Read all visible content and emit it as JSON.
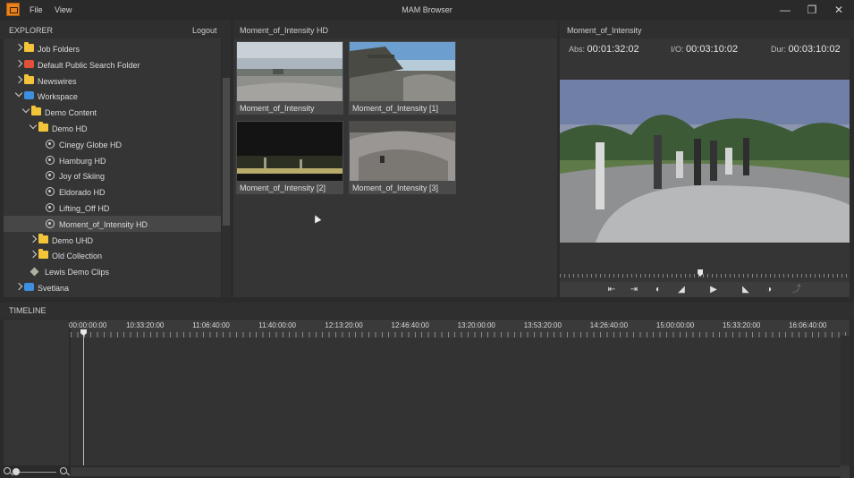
{
  "window": {
    "title": "MAM Browser",
    "menu": [
      "File",
      "View"
    ]
  },
  "explorer": {
    "title": "EXPLORER",
    "logout": "Logout",
    "items": [
      {
        "label": "Job Folders",
        "icon": "folder-icon",
        "level": 1,
        "state": "closed"
      },
      {
        "label": "Default Public Search Folder",
        "icon": "search-folder-icon",
        "level": 1,
        "state": "closed"
      },
      {
        "label": "Newswires",
        "icon": "folder-icon",
        "level": 1,
        "state": "closed"
      },
      {
        "label": "Workspace",
        "icon": "workspace-icon",
        "level": 1,
        "state": "open"
      },
      {
        "label": "Demo Content",
        "icon": "folder-icon",
        "level": 2,
        "state": "open"
      },
      {
        "label": "Demo HD",
        "icon": "folder-icon",
        "level": 3,
        "state": "open"
      },
      {
        "label": "Cinegy Globe HD",
        "icon": "clip-icon",
        "level": 4
      },
      {
        "label": "Hamburg HD",
        "icon": "clip-icon",
        "level": 4
      },
      {
        "label": "Joy of Skiing",
        "icon": "clip-icon",
        "level": 4
      },
      {
        "label": "Eldorado HD",
        "icon": "clip-icon",
        "level": 4
      },
      {
        "label": "Lifting_Off HD",
        "icon": "clip-icon",
        "level": 4
      },
      {
        "label": "Moment_of_Intensity HD",
        "icon": "clip-icon",
        "level": 4,
        "selected": true
      },
      {
        "label": "Demo UHD",
        "icon": "folder-icon",
        "level": 3,
        "state": "closed"
      },
      {
        "label": "Old Collection",
        "icon": "folder-icon",
        "level": 3,
        "state": "closed"
      },
      {
        "label": "Lewis Demo Clips",
        "icon": "diamond-icon",
        "level": 2
      },
      {
        "label": "Svetlana",
        "icon": "workspace-icon",
        "level": 1,
        "state": "closed"
      }
    ]
  },
  "content": {
    "title": "Moment_of_Intensity HD",
    "thumbnails": [
      {
        "caption": "Moment_of_Intensity"
      },
      {
        "caption": "Moment_of_Intensity [1]"
      },
      {
        "caption": "Moment_of_Intensity [2]"
      },
      {
        "caption": "Moment_of_Intensity [3]"
      }
    ]
  },
  "viewer": {
    "title": "Moment_of_Intensity",
    "abs_label": "Abs:",
    "abs_value": "00:01:32:02",
    "io_label": "I/O:",
    "io_value": "00:03:10:02",
    "dur_label": "Dur:",
    "dur_value": "00:03:10:02",
    "playback_position": 0.485
  },
  "timeline": {
    "title": "TIMELINE",
    "ruler_labels": [
      "00:00:00:00",
      "10:33:20:00",
      "11:06:40:00",
      "11:40:00:00",
      "12:13:20:00",
      "12:46:40:00",
      "13:20:00:00",
      "13:53:20:00",
      "14:26:40:00",
      "15:00:00:00",
      "15:33:20:00",
      "16:06:40:00"
    ]
  }
}
